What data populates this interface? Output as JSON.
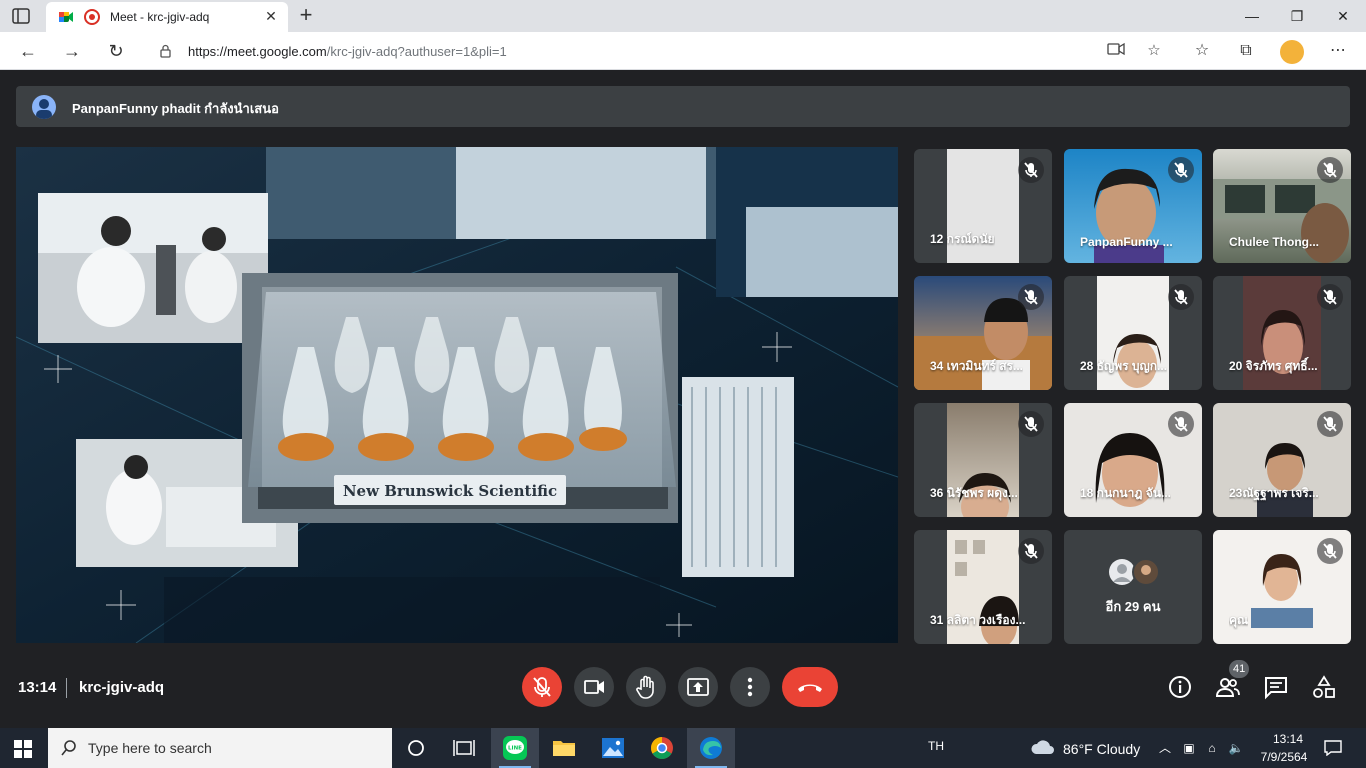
{
  "browser": {
    "tab_title": "Meet - krc-jgiv-adq",
    "url_host": "https://meet.google.com",
    "url_path": "/krc-jgiv-adq?authuser=1&pli=1"
  },
  "meet": {
    "presenter_text": "PanpanFunny phadit กำลังนำเสนอ",
    "presentation_caption": "New Brunswick Scientific",
    "participants": [
      {
        "name": "12 กรณ์ดนัย",
        "muted": true
      },
      {
        "name": "PanpanFunny ...",
        "muted": true
      },
      {
        "name": "Chulee Thong...",
        "muted": true
      },
      {
        "name": "34 เทวมินทร์ สร...",
        "muted": true
      },
      {
        "name": "28 ธัญพร บุญก...",
        "muted": true
      },
      {
        "name": "20 จิรภัทร ศุทธิ์...",
        "muted": true
      },
      {
        "name": "36 นิรัชพร ผดุง...",
        "muted": true
      },
      {
        "name": "18 กนกนาฎ จัน...",
        "muted": true
      },
      {
        "name": "23ณัฐฐาพร เจริ...",
        "muted": true
      },
      {
        "name": "31 ลลิตา วงเรือง...",
        "muted": true
      },
      {
        "name": "อีก 29 คน",
        "muted": false
      },
      {
        "name": "คุณ",
        "muted": true
      }
    ],
    "meeting_time": "13:14",
    "meeting_code": "krc-jgiv-adq",
    "people_count": "41",
    "colors": {
      "end_call": "#ea4335",
      "tile_bg": "#3c4043",
      "page_bg": "#202124"
    }
  },
  "taskbar": {
    "search_placeholder": "Type here to search",
    "language": "TH",
    "weather": "86°F  Cloudy",
    "clock_time": "13:14",
    "clock_date": "7/9/2564"
  }
}
